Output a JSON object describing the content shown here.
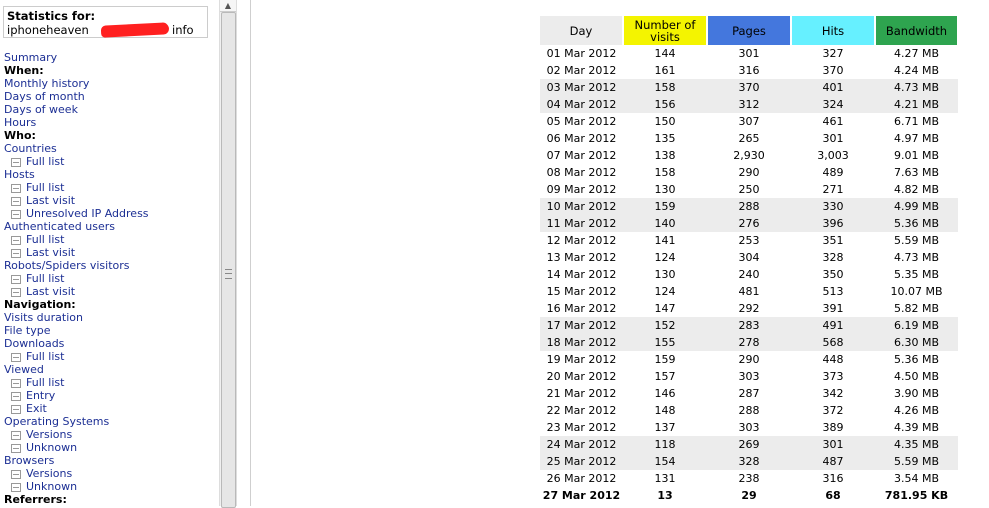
{
  "stats_for": {
    "label": "Statistics for:",
    "host_prefix": "iphoneheaven",
    "host_suffix": "info"
  },
  "menu": [
    {
      "type": "link",
      "text": "Summary"
    },
    {
      "type": "heading",
      "text": "When:"
    },
    {
      "type": "link",
      "text": "Monthly history"
    },
    {
      "type": "link",
      "text": "Days of month"
    },
    {
      "type": "link",
      "text": "Days of week"
    },
    {
      "type": "link",
      "text": "Hours"
    },
    {
      "type": "heading",
      "text": "Who:"
    },
    {
      "type": "link",
      "text": "Countries"
    },
    {
      "type": "sub",
      "text": "Full list"
    },
    {
      "type": "link",
      "text": "Hosts"
    },
    {
      "type": "sub",
      "text": "Full list"
    },
    {
      "type": "sub",
      "text": "Last visit"
    },
    {
      "type": "sub",
      "text": "Unresolved IP Address"
    },
    {
      "type": "link",
      "text": "Authenticated users"
    },
    {
      "type": "sub",
      "text": "Full list"
    },
    {
      "type": "sub",
      "text": "Last visit"
    },
    {
      "type": "link",
      "text": "Robots/Spiders visitors"
    },
    {
      "type": "sub",
      "text": "Full list"
    },
    {
      "type": "sub",
      "text": "Last visit"
    },
    {
      "type": "heading",
      "text": "Navigation:"
    },
    {
      "type": "link",
      "text": "Visits duration"
    },
    {
      "type": "link",
      "text": "File type"
    },
    {
      "type": "link",
      "text": "Downloads"
    },
    {
      "type": "sub",
      "text": "Full list"
    },
    {
      "type": "link",
      "text": "Viewed"
    },
    {
      "type": "sub",
      "text": "Full list"
    },
    {
      "type": "sub",
      "text": "Entry"
    },
    {
      "type": "sub",
      "text": "Exit"
    },
    {
      "type": "link",
      "text": "Operating Systems"
    },
    {
      "type": "sub",
      "text": "Versions"
    },
    {
      "type": "sub",
      "text": "Unknown"
    },
    {
      "type": "link",
      "text": "Browsers"
    },
    {
      "type": "sub",
      "text": "Versions"
    },
    {
      "type": "sub",
      "text": "Unknown"
    },
    {
      "type": "heading",
      "text": "Referrers:"
    }
  ],
  "table": {
    "headers": [
      {
        "text": "Day",
        "color": "#ececec"
      },
      {
        "text": "Number of visits",
        "color": "#f4f400"
      },
      {
        "text": "Pages",
        "color": "#4477dd"
      },
      {
        "text": "Hits",
        "color": "#66f0ff"
      },
      {
        "text": "Bandwidth",
        "color": "#2ea44f"
      }
    ],
    "rows": [
      [
        "01 Mar 2012",
        "144",
        "301",
        "327",
        "4.27 MB"
      ],
      [
        "02 Mar 2012",
        "161",
        "316",
        "370",
        "4.24 MB"
      ],
      [
        "03 Mar 2012",
        "158",
        "370",
        "401",
        "4.73 MB"
      ],
      [
        "04 Mar 2012",
        "156",
        "312",
        "324",
        "4.21 MB"
      ],
      [
        "05 Mar 2012",
        "150",
        "307",
        "461",
        "6.71 MB"
      ],
      [
        "06 Mar 2012",
        "135",
        "265",
        "301",
        "4.97 MB"
      ],
      [
        "07 Mar 2012",
        "138",
        "2,930",
        "3,003",
        "9.01 MB"
      ],
      [
        "08 Mar 2012",
        "158",
        "290",
        "489",
        "7.63 MB"
      ],
      [
        "09 Mar 2012",
        "130",
        "250",
        "271",
        "4.82 MB"
      ],
      [
        "10 Mar 2012",
        "159",
        "288",
        "330",
        "4.99 MB"
      ],
      [
        "11 Mar 2012",
        "140",
        "276",
        "396",
        "5.36 MB"
      ],
      [
        "12 Mar 2012",
        "141",
        "253",
        "351",
        "5.59 MB"
      ],
      [
        "13 Mar 2012",
        "124",
        "304",
        "328",
        "4.73 MB"
      ],
      [
        "14 Mar 2012",
        "130",
        "240",
        "350",
        "5.35 MB"
      ],
      [
        "15 Mar 2012",
        "124",
        "481",
        "513",
        "10.07 MB"
      ],
      [
        "16 Mar 2012",
        "147",
        "292",
        "391",
        "5.82 MB"
      ],
      [
        "17 Mar 2012",
        "152",
        "283",
        "491",
        "6.19 MB"
      ],
      [
        "18 Mar 2012",
        "155",
        "278",
        "568",
        "6.30 MB"
      ],
      [
        "19 Mar 2012",
        "159",
        "290",
        "448",
        "5.36 MB"
      ],
      [
        "20 Mar 2012",
        "157",
        "303",
        "373",
        "4.50 MB"
      ],
      [
        "21 Mar 2012",
        "146",
        "287",
        "342",
        "3.90 MB"
      ],
      [
        "22 Mar 2012",
        "148",
        "288",
        "372",
        "4.26 MB"
      ],
      [
        "23 Mar 2012",
        "137",
        "303",
        "389",
        "4.39 MB"
      ],
      [
        "24 Mar 2012",
        "118",
        "269",
        "301",
        "4.35 MB"
      ],
      [
        "25 Mar 2012",
        "154",
        "328",
        "487",
        "5.59 MB"
      ],
      [
        "26 Mar 2012",
        "131",
        "238",
        "316",
        "3.54 MB"
      ],
      [
        "27 Mar 2012",
        "13",
        "29",
        "68",
        "781.95 KB"
      ]
    ],
    "shaded_rows": [
      2,
      3,
      9,
      10,
      16,
      17,
      23,
      24
    ]
  },
  "colors": {
    "link": "#1c2f94",
    "row_shade": "#ececec"
  }
}
